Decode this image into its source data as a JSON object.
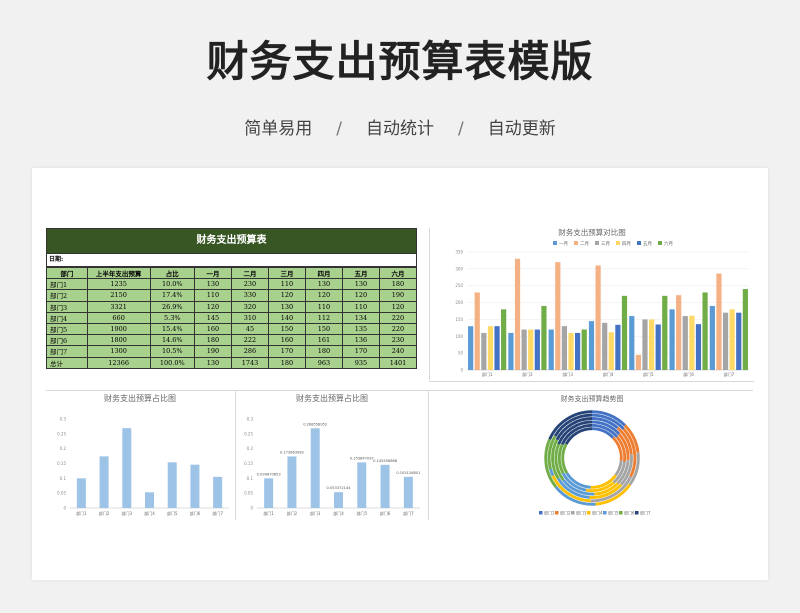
{
  "header": {
    "title": "财务支出预算表模版",
    "features": [
      "简单易用",
      "自动统计",
      "自动更新"
    ],
    "separator": "/"
  },
  "table": {
    "title": "财务支出预算表",
    "date_label": "日期:",
    "columns": [
      "部门",
      "上半年支出预算",
      "占比",
      "一月",
      "二月",
      "三月",
      "四月",
      "五月",
      "六月"
    ],
    "rows": [
      [
        "部门1",
        "1235",
        "10.0%",
        "130",
        "230",
        "110",
        "130",
        "130",
        "180"
      ],
      [
        "部门2",
        "2150",
        "17.4%",
        "110",
        "330",
        "120",
        "120",
        "120",
        "190"
      ],
      [
        "部门3",
        "3321",
        "26.9%",
        "120",
        "320",
        "130",
        "110",
        "110",
        "120"
      ],
      [
        "部门4",
        "660",
        "5.3%",
        "145",
        "310",
        "140",
        "112",
        "134",
        "220"
      ],
      [
        "部门5",
        "1900",
        "15.4%",
        "160",
        "45",
        "150",
        "150",
        "135",
        "220"
      ],
      [
        "部门6",
        "1800",
        "14.6%",
        "180",
        "222",
        "160",
        "161",
        "136",
        "230"
      ],
      [
        "部门7",
        "1300",
        "10.5%",
        "190",
        "286",
        "170",
        "180",
        "170",
        "240"
      ],
      [
        "总计",
        "12366",
        "100.0%",
        "130",
        "1743",
        "180",
        "963",
        "935",
        "1401"
      ]
    ]
  },
  "colors": {
    "table_header_bg": "#375623",
    "table_cell_bg": "#a9d18e",
    "bar_blue": "#9dc3e6",
    "months": [
      "#5b9bd5",
      "#f4b183",
      "#a5a5a5",
      "#ffd966",
      "#4472c4",
      "#70ad47"
    ]
  },
  "chart_data": [
    {
      "type": "bar",
      "title": "财务支出预算对比图",
      "categories": [
        "部门1",
        "部门2",
        "部门3",
        "部门4",
        "部门5",
        "部门6",
        "部门7"
      ],
      "yticks": [
        "0",
        "50",
        "100",
        "150",
        "200",
        "250",
        "300",
        "350"
      ],
      "ylim": [
        0,
        350
      ],
      "legend_position": "top",
      "series": [
        {
          "name": "一月",
          "values": [
            130,
            110,
            120,
            145,
            160,
            180,
            190
          ]
        },
        {
          "name": "二月",
          "values": [
            230,
            330,
            320,
            310,
            45,
            222,
            286
          ]
        },
        {
          "name": "三月",
          "values": [
            110,
            120,
            130,
            140,
            150,
            160,
            170
          ]
        },
        {
          "name": "四月",
          "values": [
            130,
            120,
            110,
            112,
            150,
            161,
            180
          ]
        },
        {
          "name": "五月",
          "values": [
            130,
            120,
            110,
            134,
            135,
            136,
            170
          ]
        },
        {
          "name": "六月",
          "values": [
            180,
            190,
            120,
            220,
            220,
            230,
            240
          ]
        }
      ]
    },
    {
      "type": "bar",
      "title": "财务支出预算占比图",
      "categories": [
        "部门1",
        "部门2",
        "部门3",
        "部门4",
        "部门5",
        "部门6",
        "部门7"
      ],
      "values": [
        0.1,
        0.174,
        0.269,
        0.053,
        0.154,
        0.146,
        0.105
      ],
      "yticks": [
        "0",
        "0.05",
        "0.1",
        "0.15",
        "0.2",
        "0.25",
        "0.3"
      ],
      "ylim": [
        0,
        0.3
      ]
    },
    {
      "type": "bar",
      "title": "财务支出预算占比图",
      "categories": [
        "部门1",
        "部门2",
        "部门3",
        "部门4",
        "部门5",
        "部门6",
        "部门7"
      ],
      "values": [
        0.099870853,
        0.173863982,
        0.268558952,
        0.053372144,
        0.153647097,
        0.145556868,
        0.105126801
      ],
      "data_labels": [
        "0.099870853",
        "0.173863982",
        "0.268558952",
        "0.053372144",
        "0.153647097",
        "0.145556868",
        "0.105126801"
      ],
      "yticks": [
        "0",
        "0.05",
        "0.1",
        "0.15",
        "0.2",
        "0.25",
        "0.3"
      ],
      "ylim": [
        0,
        0.3
      ]
    },
    {
      "type": "pie",
      "title": "财务支出预算趋势图",
      "legend_position": "bottom",
      "categories": [
        "部门1",
        "部门2",
        "部门3",
        "部门4",
        "部门5",
        "部门6",
        "部门7"
      ],
      "rings": [
        {
          "name": "一月",
          "values": [
            130,
            110,
            120,
            145,
            160,
            180,
            190
          ]
        },
        {
          "name": "二月",
          "values": [
            230,
            330,
            320,
            310,
            45,
            222,
            286
          ]
        },
        {
          "name": "三月",
          "values": [
            110,
            120,
            130,
            140,
            150,
            160,
            170
          ]
        },
        {
          "name": "四月",
          "values": [
            130,
            120,
            110,
            112,
            150,
            161,
            180
          ]
        },
        {
          "name": "五月",
          "values": [
            130,
            120,
            110,
            134,
            135,
            136,
            170
          ]
        },
        {
          "name": "六月",
          "values": [
            180,
            190,
            120,
            220,
            220,
            230,
            240
          ]
        }
      ],
      "slice_colors": [
        "#4472c4",
        "#ed7d31",
        "#a5a5a5",
        "#ffc000",
        "#5b9bd5",
        "#70ad47",
        "#264478"
      ]
    }
  ]
}
